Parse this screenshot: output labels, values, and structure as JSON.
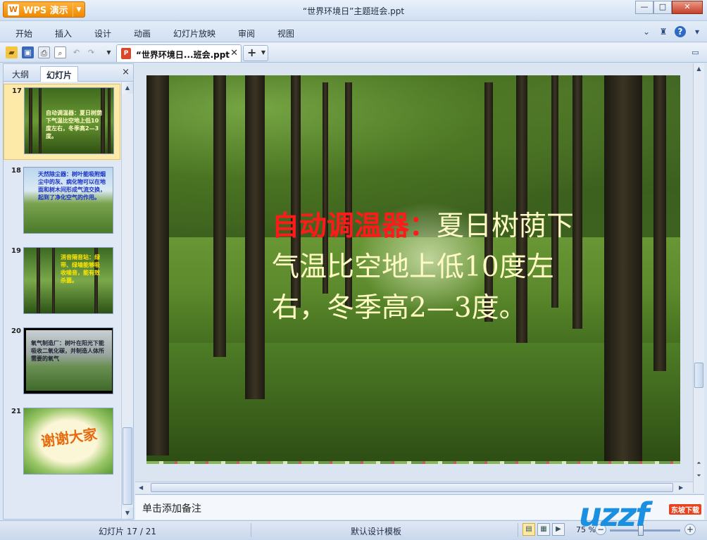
{
  "app": {
    "logo_label": "WPS 演示",
    "window_title": "“世界环境日”主题班会.ppt"
  },
  "menu": [
    "开始",
    "插入",
    "设计",
    "动画",
    "幻灯片放映",
    "审阅",
    "视图"
  ],
  "toolbar": {
    "icons": [
      "open-icon",
      "save-icon",
      "print-icon",
      "print-preview-icon",
      "undo-icon",
      "redo-icon",
      "customize-icon"
    ],
    "doc_tab_label": "“世界环境日...班会.ppt",
    "new_tab_label": "+"
  },
  "panel": {
    "tabs": [
      "大纲",
      "幻灯片"
    ],
    "active_tab": "幻灯片",
    "close_label": "×",
    "thumbnails": [
      {
        "number": "17",
        "text": "自动调温器：夏日树荫下气温比空地上低10度左右，冬季高2—3度。"
      },
      {
        "number": "18",
        "text": "天然除尘器：树叶能吸附烟尘中的灰、病化物可以在地面和树木间形成气流交换，起到了净化空气的作用。"
      },
      {
        "number": "19",
        "text": "消音隔音站：绿带、绿墙能够吸收噪音，能有效杀菌。"
      },
      {
        "number": "20",
        "text": "氧气制造厂：树叶在阳光下能吸收二氧化碳，并制造人体所需要的氧气"
      },
      {
        "number": "21",
        "text": "谢谢大家"
      }
    ]
  },
  "slide": {
    "title_red": "自动调温器：",
    "body": "夏日树荫下气温比空地上低10度左右，冬季高2—3度。"
  },
  "notes": {
    "placeholder": "单击添加备注"
  },
  "status": {
    "slide_counter": "幻灯片 17 / 21",
    "template": "默认设计模板",
    "zoom": "75 %"
  },
  "watermark": {
    "text": "uzzf",
    "badge": "东坡下载"
  },
  "colors": {
    "accent": "#f08a00",
    "slide_title": "#ff1a1a",
    "slide_body": "#fffbc4"
  }
}
